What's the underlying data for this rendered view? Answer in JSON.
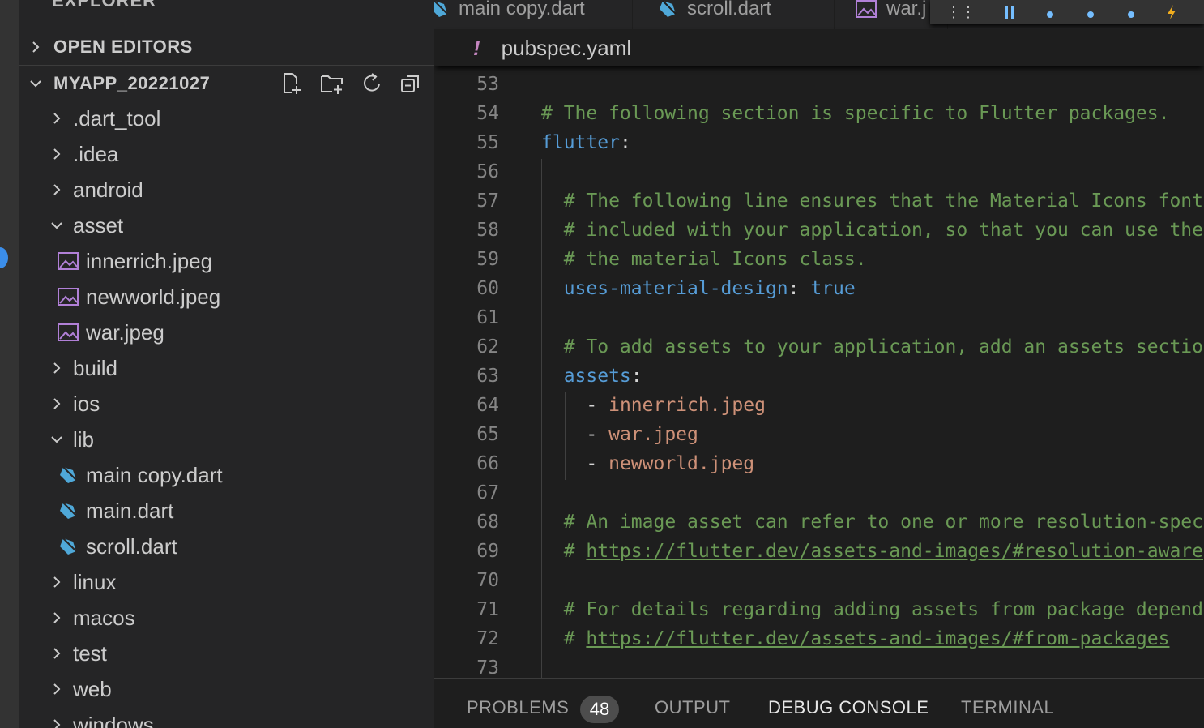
{
  "sidebar": {
    "title": "EXPLORER",
    "more": "···",
    "open_editors": "OPEN EDITORS",
    "project": "MYAPP_20221027",
    "tree": [
      {
        "label": ".dart_tool",
        "type": "folder",
        "expanded": false
      },
      {
        "label": ".idea",
        "type": "folder",
        "expanded": false
      },
      {
        "label": "android",
        "type": "folder",
        "expanded": false
      },
      {
        "label": "asset",
        "type": "folder",
        "expanded": true
      },
      {
        "label": "innerrich.jpeg",
        "type": "image"
      },
      {
        "label": "newworld.jpeg",
        "type": "image"
      },
      {
        "label": "war.jpeg",
        "type": "image"
      },
      {
        "label": "build",
        "type": "folder",
        "expanded": false
      },
      {
        "label": "ios",
        "type": "folder",
        "expanded": false
      },
      {
        "label": "lib",
        "type": "folder",
        "expanded": true
      },
      {
        "label": "main copy.dart",
        "type": "dart"
      },
      {
        "label": "main.dart",
        "type": "dart"
      },
      {
        "label": "scroll.dart",
        "type": "dart"
      },
      {
        "label": "linux",
        "type": "folder",
        "expanded": false
      },
      {
        "label": "macos",
        "type": "folder",
        "expanded": false
      },
      {
        "label": "test",
        "type": "folder",
        "expanded": false
      },
      {
        "label": "web",
        "type": "folder",
        "expanded": false
      },
      {
        "label": "windows",
        "type": "folder",
        "expanded": false
      }
    ]
  },
  "tabs": [
    {
      "label": "main copy.dart",
      "icon": "dart-icon"
    },
    {
      "label": "scroll.dart",
      "icon": "dart-icon"
    },
    {
      "label": "war.j",
      "icon": "image-icon"
    }
  ],
  "breadcrumb": {
    "marker": "!",
    "file": "pubspec.yaml"
  },
  "code": {
    "lines": [
      {
        "n": "53",
        "parts": []
      },
      {
        "n": "54",
        "parts": [
          [
            "c-comment",
            "# The following section is specific to Flutter packages."
          ]
        ]
      },
      {
        "n": "55",
        "parts": [
          [
            "c-key",
            "flutter"
          ],
          [
            "c-punc",
            ":"
          ]
        ]
      },
      {
        "n": "56",
        "parts": []
      },
      {
        "n": "57",
        "parts": [
          [
            "c-comment",
            "  # The following line ensures that the Material Icons font is"
          ]
        ]
      },
      {
        "n": "58",
        "parts": [
          [
            "c-comment",
            "  # included with your application, so that you can use the icons in"
          ]
        ]
      },
      {
        "n": "59",
        "parts": [
          [
            "c-comment",
            "  # the material Icons class."
          ]
        ]
      },
      {
        "n": "60",
        "parts": [
          [
            "c-key",
            "  uses-material-design"
          ],
          [
            "c-punc",
            ": "
          ],
          [
            "c-bool",
            "true"
          ]
        ]
      },
      {
        "n": "61",
        "parts": []
      },
      {
        "n": "62",
        "parts": [
          [
            "c-comment",
            "  # To add assets to your application, add an assets section, like this:"
          ]
        ]
      },
      {
        "n": "63",
        "parts": [
          [
            "c-key",
            "  assets"
          ],
          [
            "c-punc",
            ":"
          ]
        ]
      },
      {
        "n": "64",
        "parts": [
          [
            "c-punc",
            "    - "
          ],
          [
            "c-str",
            "innerrich.jpeg"
          ]
        ]
      },
      {
        "n": "65",
        "parts": [
          [
            "c-punc",
            "    - "
          ],
          [
            "c-str",
            "war.jpeg"
          ]
        ]
      },
      {
        "n": "66",
        "parts": [
          [
            "c-punc",
            "    - "
          ],
          [
            "c-str",
            "newworld.jpeg"
          ]
        ]
      },
      {
        "n": "67",
        "parts": []
      },
      {
        "n": "68",
        "parts": [
          [
            "c-comment",
            "  # An image asset can refer to one or more resolution-specific \"variants\", see"
          ]
        ]
      },
      {
        "n": "69",
        "parts": [
          [
            "c-comment",
            "  # "
          ],
          [
            "c-link",
            "https://flutter.dev/assets-and-images/#resolution-aware"
          ]
        ]
      },
      {
        "n": "70",
        "parts": []
      },
      {
        "n": "71",
        "parts": [
          [
            "c-comment",
            "  # For details regarding adding assets from package dependencies, see"
          ]
        ]
      },
      {
        "n": "72",
        "parts": [
          [
            "c-comment",
            "  # "
          ],
          [
            "c-link",
            "https://flutter.dev/assets-and-images/#from-packages"
          ]
        ]
      },
      {
        "n": "73",
        "parts": []
      }
    ]
  },
  "panel": {
    "problems": "PROBLEMS",
    "problems_count": "48",
    "output": "OUTPUT",
    "debug_console": "DEBUG CONSOLE",
    "terminal": "TERMINAL"
  },
  "colors": {
    "accent": "#3b8eea",
    "dart": "#4fa8d8",
    "image": "#b180d7"
  }
}
